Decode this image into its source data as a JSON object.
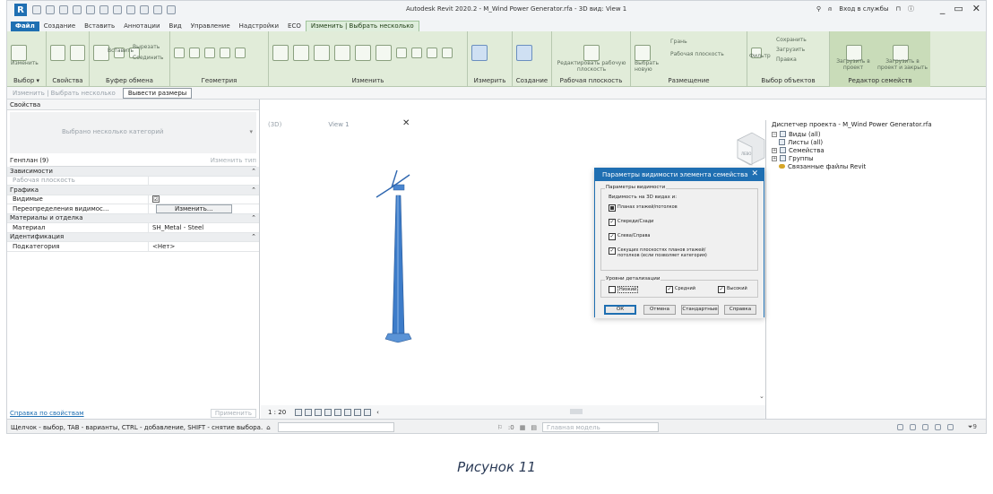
{
  "titlebar": {
    "title": "Autodesk Revit 2020.2 - M_Wind Power Generator.rfa - 3D вид: View 1",
    "signin": "Вход в службы",
    "window_buttons": [
      "_",
      "▭",
      "✕"
    ]
  },
  "tabs": [
    "Файл",
    "Создание",
    "Вставить",
    "Аннотации",
    "Вид",
    "Управление",
    "Надстройки",
    "ECO",
    "Изменить | Выбрать несколько"
  ],
  "ribbon": {
    "groups": [
      {
        "label": "Выбор ▾",
        "texts": [
          "Изменить"
        ]
      },
      {
        "label": "Свойства",
        "texts": []
      },
      {
        "label": "Буфер обмена",
        "texts": [
          "Вставить",
          "Вырезать",
          "Соединить"
        ]
      },
      {
        "label": "Геометрия",
        "texts": []
      },
      {
        "label": "Изменить",
        "texts": []
      },
      {
        "label": "Измерить",
        "texts": []
      },
      {
        "label": "Создание",
        "texts": []
      },
      {
        "label": "Рабочая плоскость",
        "texts": [
          "Редактировать рабочую плоскость"
        ]
      },
      {
        "label": "Размещение",
        "texts": [
          "Выбрать новую",
          "Грань",
          "Рабочая плоскость"
        ]
      },
      {
        "label": "Выбор объектов",
        "texts": [
          "Фильтр",
          "Сохранить",
          "Загрузить",
          "Правка"
        ]
      },
      {
        "label": "Редактор семейств",
        "texts": [
          "Загрузить в проект",
          "Загрузить в проект и закрыть"
        ]
      }
    ]
  },
  "optbar": {
    "mode": "Изменить | Выбрать несколько",
    "button": "Вывести размеры"
  },
  "properties": {
    "title": "Свойства",
    "type_selector": "Выбрано несколько категорий",
    "filter": "Генплан (9)",
    "edit_type": "Изменить тип",
    "rows": [
      {
        "kind": "cat",
        "name": "Зависимости"
      },
      {
        "kind": "prop",
        "name": "Рабочая плоскость",
        "value": "",
        "gray": true
      },
      {
        "kind": "cat",
        "name": "Графика"
      },
      {
        "kind": "prop",
        "name": "Видимые",
        "value": "☑"
      },
      {
        "kind": "prop",
        "name": "Переопределения видимос...",
        "value": "Изменить..."
      },
      {
        "kind": "cat",
        "name": "Материалы и отделка"
      },
      {
        "kind": "prop",
        "name": "Материал",
        "value": "SH_Metal - Steel"
      },
      {
        "kind": "cat",
        "name": "Идентификация"
      },
      {
        "kind": "prop",
        "name": "Подкатегория",
        "value": "<Нет>"
      }
    ],
    "help": "Справка по свойствам",
    "apply": "Применить"
  },
  "view": {
    "tabs": [
      "(3D)",
      "View 1"
    ],
    "scale": "1 : 20",
    "viewcube_label": "ЛЕВО"
  },
  "browser": {
    "title": "Диспетчер проекта - M_Wind Power Generator.rfa",
    "items": [
      {
        "label": "Виды (all)",
        "pm": "−",
        "child": false
      },
      {
        "label": "Листы (all)",
        "pm": "",
        "child": true
      },
      {
        "label": "Семейства",
        "pm": "+",
        "child": false
      },
      {
        "label": "Группы",
        "pm": "+",
        "child": false
      },
      {
        "label": "Связанные файлы Revit",
        "pm": "",
        "child": false,
        "link": true
      }
    ]
  },
  "statusbar": {
    "hint": "Щелчок - выбор, TAB - варианты, CTRL - добавление, SHIFT - снятие выбора.",
    "zero": ":0",
    "model": "Главная модель",
    "filter_count": "9"
  },
  "dialog": {
    "title": "Параметры видимости элемента семейства",
    "group1_legend": "Параметры видимости",
    "views3d_label": "Видимость на 3D видах и:",
    "checks": [
      {
        "label": "Планах этажей/потолков",
        "state": "filled"
      },
      {
        "label": "Спереди/Сзади",
        "state": "checked"
      },
      {
        "label": "Слева/Справа",
        "state": "checked"
      },
      {
        "label": "Секущих плоскостях планов этажей/потолков (если позволяет категория)",
        "state": "checked"
      }
    ],
    "group2_legend": "Уровни детализации",
    "details": [
      {
        "label": "Низкий",
        "state": "unchecked"
      },
      {
        "label": "Средний",
        "state": "checked"
      },
      {
        "label": "Высокий",
        "state": "checked"
      }
    ],
    "buttons": {
      "ok": "ОК",
      "cancel": "Отмена",
      "default": "Стандартные",
      "help": "Справка"
    }
  },
  "caption": "Рисунок 11"
}
